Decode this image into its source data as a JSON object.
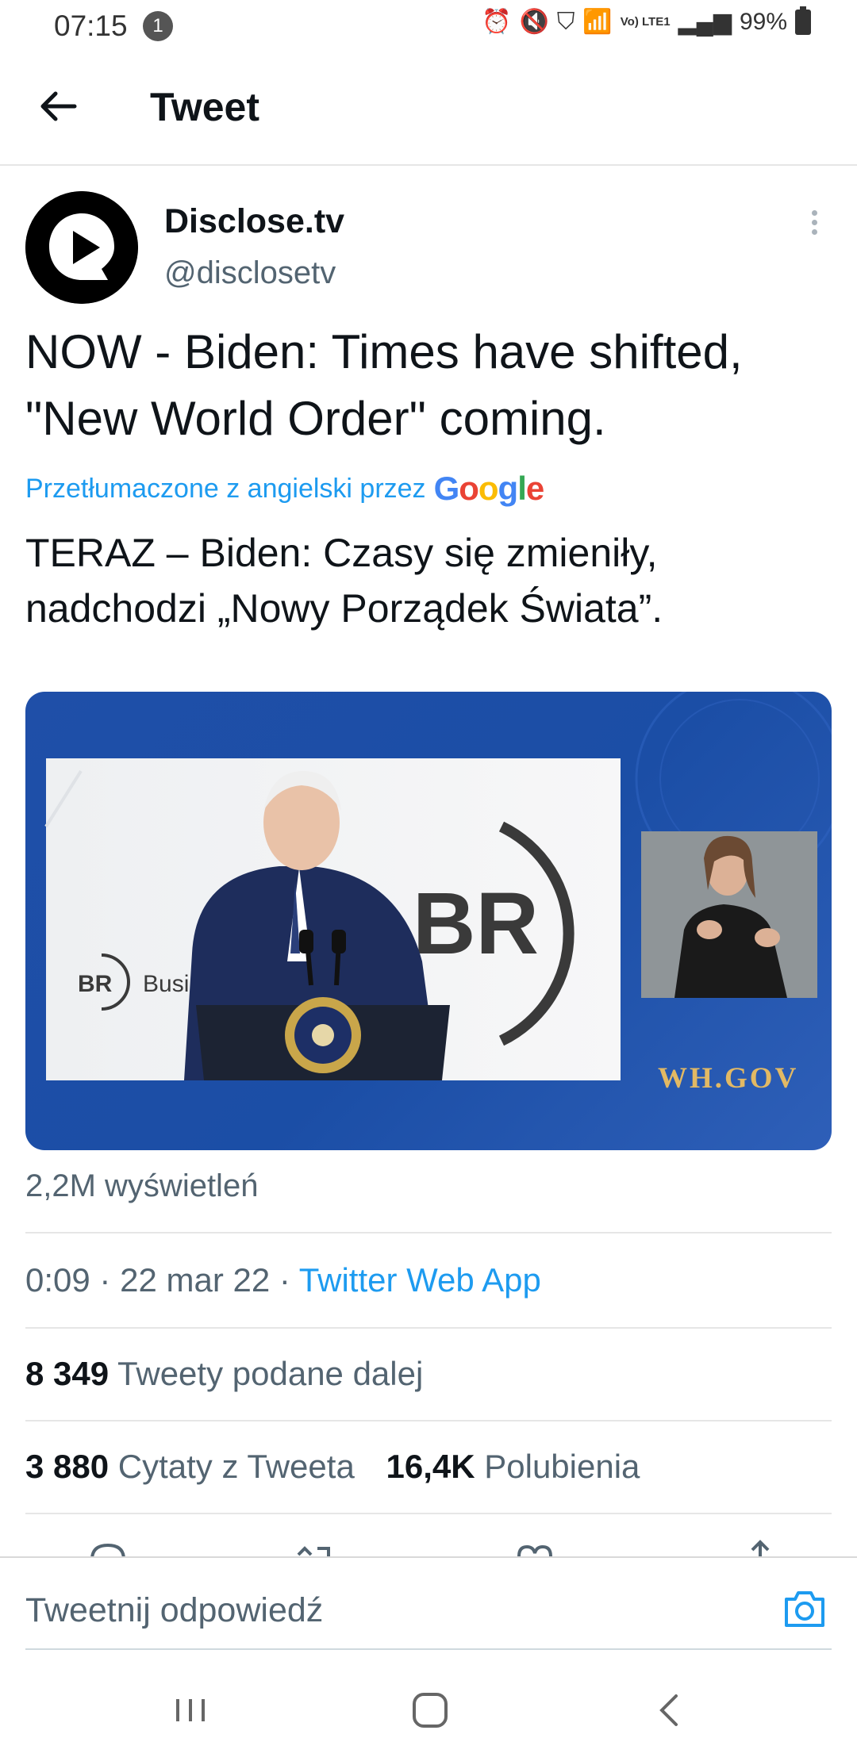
{
  "status_bar": {
    "time": "07:15",
    "notification_count": "1",
    "network": "Vo) LTE1",
    "battery": "99%"
  },
  "header": {
    "title": "Tweet"
  },
  "tweet": {
    "author_name": "Disclose.tv",
    "author_handle": "@disclosetv",
    "text": "NOW - Biden: Times have shifted, \"New World Order\" coming.",
    "translated_by": "Przetłumaczone z angielski przez",
    "translation_provider": "Google",
    "translated_text": "TERAZ – Biden: Czasy się zmieniły, nadchodzi „Nowy Porządek Świata”.",
    "media": {
      "watermark": "WH.GOV",
      "backdrop_logo": "BR",
      "backdrop_caption": "Busi"
    },
    "views": "2,2M wyświetleń",
    "time": "0:09",
    "separator": "·",
    "date": "22 mar 22",
    "source": "Twitter Web App",
    "retweets": {
      "count": "8 349",
      "label": "Tweety podane dalej"
    },
    "quotes": {
      "count": "3 880",
      "label": "Cytaty z Tweeta"
    },
    "likes": {
      "count": "16,4K",
      "label": "Polubienia"
    }
  },
  "reply_bar": {
    "placeholder": "Tweetnij odpowiedź"
  },
  "colors": {
    "accent": "#1d9bf0",
    "media_background": "#1f4fa8",
    "watermark": "#e2b964"
  },
  "icons": [
    "back-arrow-icon",
    "more-vertical-icon",
    "camera-icon",
    "recent-apps-icon",
    "home-icon",
    "back-nav-icon"
  ]
}
